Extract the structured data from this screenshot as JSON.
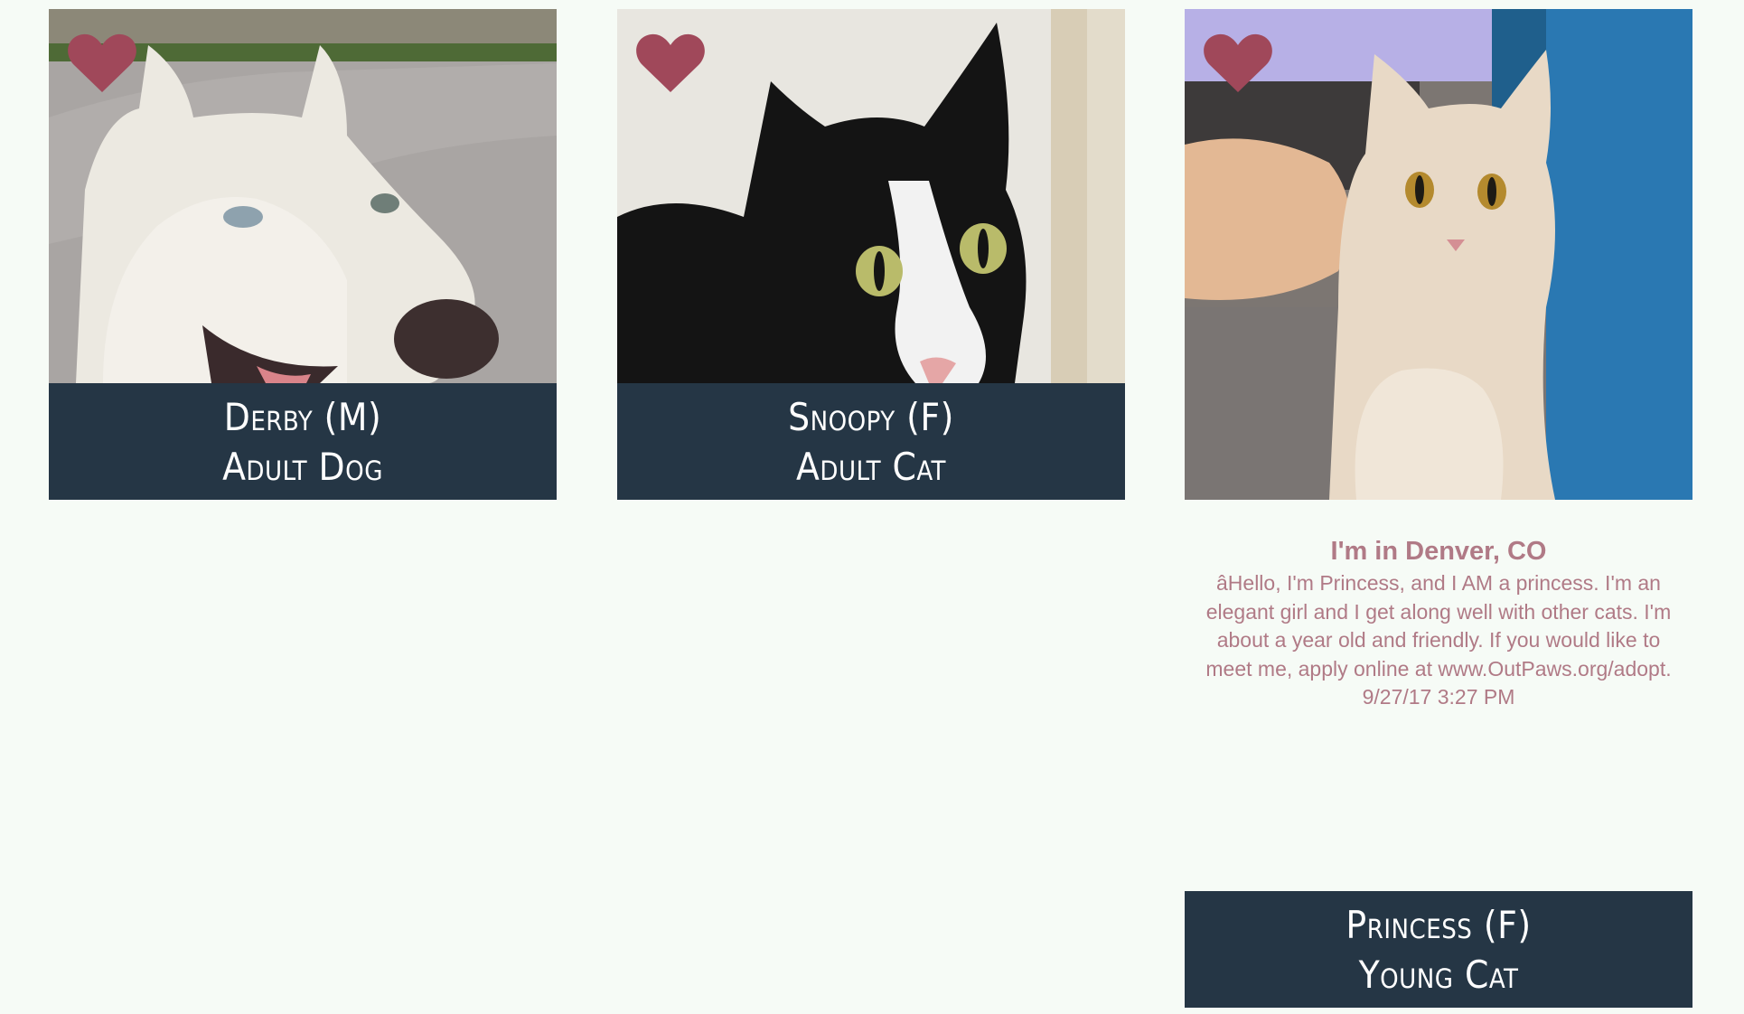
{
  "cards": [
    {
      "name": "Derby (M)",
      "type": "Adult Dog",
      "favorite": true,
      "photo": "white-husky-dog-photo"
    },
    {
      "name": "Snoopy (F)",
      "type": "Adult Cat",
      "favorite": true,
      "photo": "black-white-cat-photo"
    },
    {
      "name": "Princess (F)",
      "type": "Young Cat",
      "favorite": true,
      "photo": "cream-cat-photo",
      "location": "I'm in Denver, CO",
      "description": "âHello, I'm Princess, and I AM a princess. I'm an elegant girl and I get along well with other cats. I'm about a year old and friendly. If you would like to meet me, apply online at www.OutPaws.org/adopt.",
      "timestamp": "9/27/17 3:27 PM"
    }
  ],
  "colors": {
    "background": "#f6fbf6",
    "caption_bg": "#253645",
    "caption_text": "#ffffff",
    "heart": "#a0485a",
    "details_text": "#b07a86"
  }
}
